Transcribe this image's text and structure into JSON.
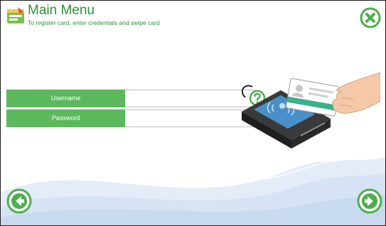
{
  "header": {
    "title": "Main Menu",
    "subtitle": "To register card, enter credentials and swipe card"
  },
  "form": {
    "username": {
      "label": "Username",
      "value": "",
      "placeholder": ""
    },
    "password": {
      "label": "Password",
      "value": "",
      "placeholder": ""
    }
  },
  "icons": {
    "app": "app-menu-icon",
    "close": "close-icon",
    "help": "help-icon",
    "back": "arrow-left-icon",
    "next": "arrow-right-icon"
  },
  "colors": {
    "accent": "#5cb85c",
    "title": "#2f8f3a",
    "card_stripe": "#3cb08a"
  }
}
